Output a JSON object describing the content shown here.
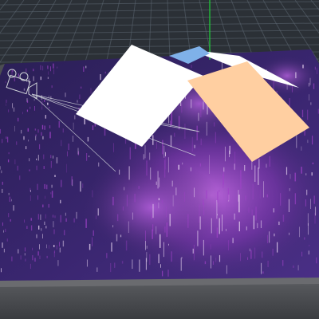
{
  "viewport": {
    "view": "perspective",
    "background_color": "#2b3036",
    "grid_color": "#5d6873",
    "y_axis_color": "#1fd23a"
  },
  "terrain": {
    "base_color": "#2d1f55",
    "highlight_color": "#a042c8",
    "peak_color": "#e9d6f2",
    "edge_color": "#56575a"
  },
  "objects": [
    {
      "name": "white-plane",
      "color": "#ffffff"
    },
    {
      "name": "peach-plane",
      "color": "#ffcfa1"
    },
    {
      "name": "blue-plane",
      "color": "#7fb1e9"
    },
    {
      "name": "back-white-plane",
      "color": "#ffffff"
    },
    {
      "name": "camera",
      "icon": "camera-icon",
      "color": "#cfd3d8"
    }
  ]
}
